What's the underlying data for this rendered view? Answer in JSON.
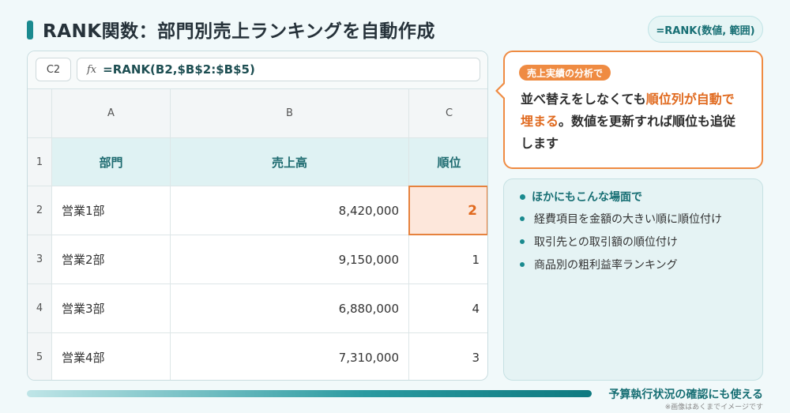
{
  "page": {
    "title": "RANK関数：部門別売上ランキングを自動作成",
    "formula_badge": "=RANK(数値, 範囲)"
  },
  "sheet": {
    "cell_ref": "C2",
    "fx_label": "fx",
    "formula": "=RANK(B2,$B$2:$B$5)",
    "columns": [
      "A",
      "B",
      "C"
    ],
    "rows": [
      "1",
      "2",
      "3",
      "4",
      "5"
    ],
    "headers": [
      "部門",
      "売上高",
      "順位"
    ],
    "data": [
      [
        "営業1部",
        "8,420,000",
        "2"
      ],
      [
        "営業2部",
        "9,150,000",
        "1"
      ],
      [
        "営業3部",
        "6,880,000",
        "4"
      ],
      [
        "営業4部",
        "7,310,000",
        "3"
      ]
    ]
  },
  "callout": {
    "tag": "売上実績の分析で",
    "line1_a": "並べ替えをしなくても",
    "line1_hl": "順位列が自動で",
    "line2_hl": "埋まる",
    "line2_b": "。数値を更新すれば順位も追従",
    "line3": "します"
  },
  "uses": {
    "heading": "ほかにもこんな場面で",
    "items": [
      "経費項目を金額の大きい順に順位付け",
      "取引先との取引額の順位付け",
      "商品別の粗利益率ランキング"
    ]
  },
  "footer": {
    "text": "予算執行状況の確認にも使える",
    "note": "※画像はあくまでイメージです"
  },
  "colors": {
    "accent": "#1a8a8f",
    "highlight": "#ef8b42"
  }
}
